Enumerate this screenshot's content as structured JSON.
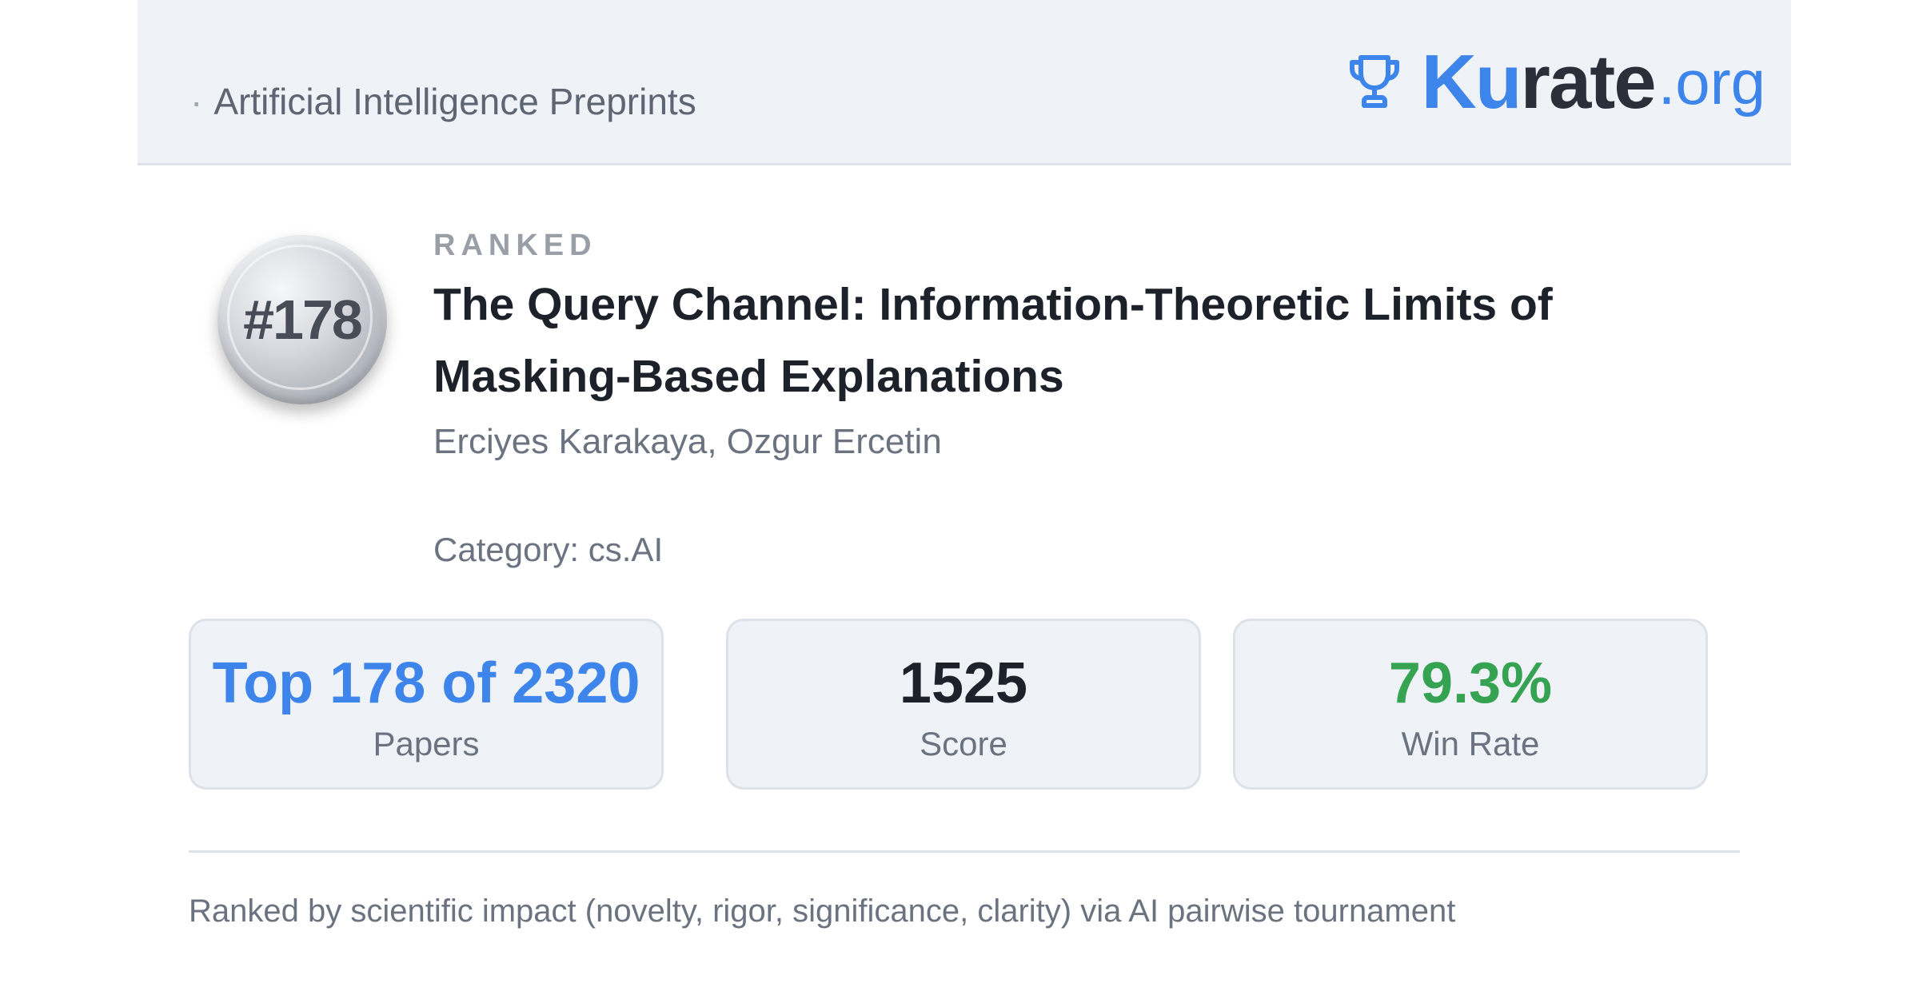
{
  "header": {
    "breadcrumb_separator": "·",
    "breadcrumb": "Artificial Intelligence Preprints",
    "brand": {
      "icon": "trophy-icon",
      "part_accent": "Ku",
      "part_dark": "rate",
      "suffix": ".org",
      "accent_color": "#3d85eb"
    }
  },
  "paper": {
    "rank_badge": "#178",
    "ranked_label": "RANKED",
    "title": "The Query Channel: Information-Theoretic Limits of Masking-Based Explanations",
    "authors": "Erciyes Karakaya, Ozgur Ercetin",
    "category": "Category: cs.AI"
  },
  "stats": [
    {
      "value": "Top 178 of 2320",
      "label": "Papers",
      "color": "#3d85eb"
    },
    {
      "value": "1525",
      "label": "Score",
      "color": "#1d2129"
    },
    {
      "value": "79.3%",
      "label": "Win Rate",
      "color": "#35a352"
    }
  ],
  "footer": {
    "note": "Ranked by scientific impact (novelty, rigor, significance, clarity) via AI pairwise tournament"
  }
}
